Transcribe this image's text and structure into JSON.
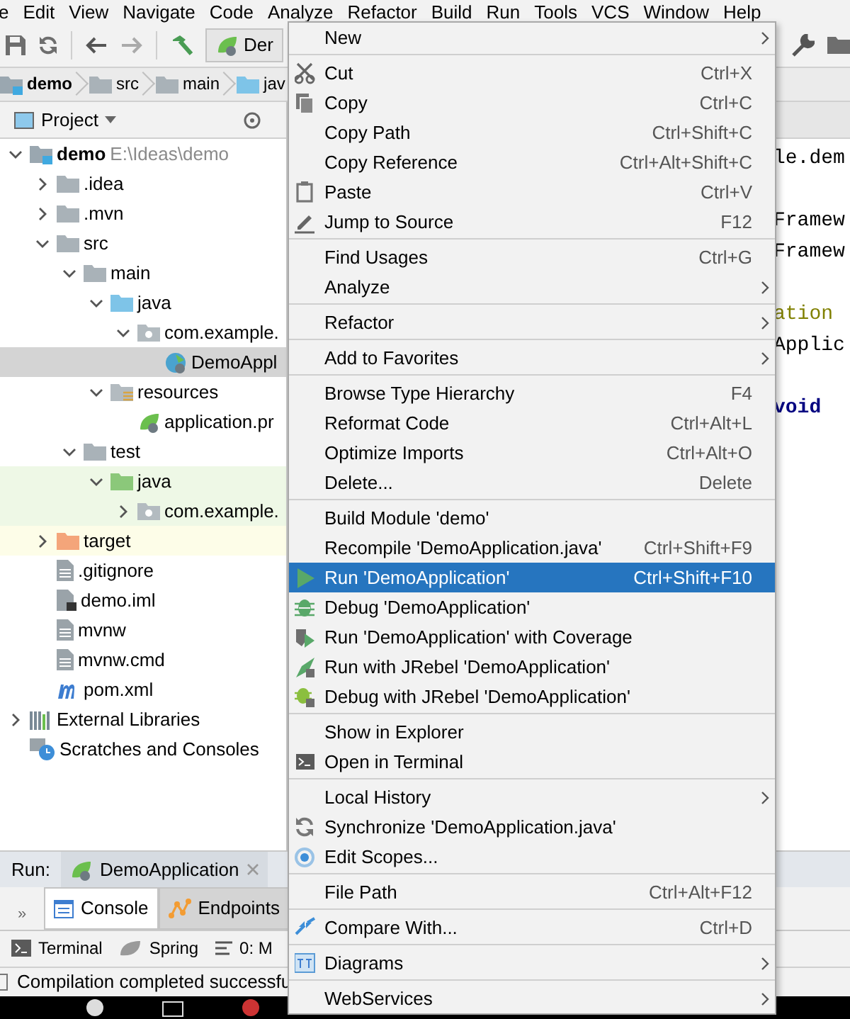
{
  "menubar": [
    "e",
    "Edit",
    "View",
    "Navigate",
    "Code",
    "Analyze",
    "Refactor",
    "Build",
    "Run",
    "Tools",
    "VCS",
    "Window",
    "Help"
  ],
  "toolbar": {
    "run_config": "Der"
  },
  "breadcrumbs": [
    {
      "label": "demo",
      "kind": "module"
    },
    {
      "label": "src",
      "kind": "folder"
    },
    {
      "label": "main",
      "kind": "folder"
    },
    {
      "label": "jav",
      "kind": "source-folder"
    }
  ],
  "project_panel": {
    "title": "Project",
    "tree": [
      {
        "label": "demo",
        "hint": "E:\\Ideas\\demo",
        "kind": "module",
        "expanded": true,
        "selected": false,
        "children": [
          {
            "label": ".idea",
            "kind": "folder",
            "expanded": false,
            "selected": false
          },
          {
            "label": ".mvn",
            "kind": "folder",
            "expanded": false,
            "selected": false
          },
          {
            "label": "src",
            "kind": "folder",
            "expanded": true,
            "selected": false,
            "children": [
              {
                "label": "main",
                "kind": "folder",
                "expanded": true,
                "selected": false,
                "children": [
                  {
                    "label": "java",
                    "kind": "source-folder",
                    "expanded": true,
                    "selected": false,
                    "children": [
                      {
                        "label": "com.example.",
                        "kind": "package",
                        "expanded": true,
                        "selected": false,
                        "children": [
                          {
                            "label": "DemoAppl",
                            "kind": "spring-class",
                            "selected": true
                          }
                        ]
                      }
                    ]
                  },
                  {
                    "label": "resources",
                    "kind": "resource-folder",
                    "expanded": true,
                    "selected": false,
                    "children": [
                      {
                        "label": "application.pr",
                        "kind": "spring-config",
                        "selected": false
                      }
                    ]
                  }
                ]
              },
              {
                "label": "test",
                "kind": "folder",
                "expanded": true,
                "selected": false,
                "children": [
                  {
                    "label": "java",
                    "kind": "test-folder",
                    "expanded": true,
                    "selected": false,
                    "children": [
                      {
                        "label": "com.example.",
                        "kind": "package",
                        "expanded": false,
                        "selected": false
                      }
                    ]
                  }
                ]
              }
            ]
          },
          {
            "label": "target",
            "kind": "excluded-folder",
            "expanded": false,
            "selected": false
          },
          {
            "label": ".gitignore",
            "kind": "file",
            "selected": false
          },
          {
            "label": "demo.iml",
            "kind": "iml",
            "selected": false
          },
          {
            "label": "mvnw",
            "kind": "file",
            "selected": false
          },
          {
            "label": "mvnw.cmd",
            "kind": "file",
            "selected": false
          },
          {
            "label": "pom.xml",
            "kind": "maven",
            "selected": false
          }
        ]
      },
      {
        "label": "External Libraries",
        "kind": "libraries",
        "expanded": false,
        "selected": false
      },
      {
        "label": "Scratches and Consoles",
        "kind": "scratches",
        "selected": false
      }
    ]
  },
  "editor": {
    "lines": [
      {
        "text": "le.dem",
        "kind": "plain"
      },
      {
        "text": "Framew",
        "kind": "plain"
      },
      {
        "text": "Framew",
        "kind": "plain"
      },
      {
        "text": "ation",
        "kind": "annotation"
      },
      {
        "text": "Applic",
        "kind": "plain"
      },
      {
        "text": "void",
        "kind": "keyword"
      }
    ]
  },
  "run_panel": {
    "label": "Run:",
    "tab": "DemoApplication",
    "more": "»",
    "tabs": [
      {
        "label": "Console",
        "selected": true
      },
      {
        "label": "Endpoints",
        "selected": false
      }
    ]
  },
  "tool_windows": [
    "Terminal",
    "Spring",
    "0: M"
  ],
  "status_bar": "Compilation completed successfu",
  "context_menu": {
    "groups": [
      [
        {
          "label": "New",
          "submenu": true,
          "selected": false
        }
      ],
      [
        {
          "label": "Cut",
          "shortcut": "Ctrl+X",
          "submenu": false,
          "selected": false
        },
        {
          "label": "Copy",
          "shortcut": "Ctrl+C",
          "submenu": false,
          "selected": false
        },
        {
          "label": "Copy Path",
          "shortcut": "Ctrl+Shift+C",
          "submenu": false,
          "selected": false
        },
        {
          "label": "Copy Reference",
          "shortcut": "Ctrl+Alt+Shift+C",
          "submenu": false,
          "selected": false
        },
        {
          "label": "Paste",
          "shortcut": "Ctrl+V",
          "submenu": false,
          "selected": false
        },
        {
          "label": "Jump to Source",
          "shortcut": "F12",
          "submenu": false,
          "selected": false
        }
      ],
      [
        {
          "label": "Find Usages",
          "shortcut": "Ctrl+G",
          "submenu": false,
          "selected": false
        },
        {
          "label": "Analyze",
          "submenu": true,
          "selected": false
        }
      ],
      [
        {
          "label": "Refactor",
          "submenu": true,
          "selected": false
        }
      ],
      [
        {
          "label": "Add to Favorites",
          "submenu": true,
          "selected": false
        }
      ],
      [
        {
          "label": "Browse Type Hierarchy",
          "shortcut": "F4",
          "submenu": false,
          "selected": false
        },
        {
          "label": "Reformat Code",
          "shortcut": "Ctrl+Alt+L",
          "submenu": false,
          "selected": false
        },
        {
          "label": "Optimize Imports",
          "shortcut": "Ctrl+Alt+O",
          "submenu": false,
          "selected": false
        },
        {
          "label": "Delete...",
          "shortcut": "Delete",
          "submenu": false,
          "selected": false
        }
      ],
      [
        {
          "label": "Build Module 'demo'",
          "submenu": false,
          "selected": false
        },
        {
          "label": "Recompile 'DemoApplication.java'",
          "shortcut": "Ctrl+Shift+F9",
          "submenu": false,
          "selected": false
        },
        {
          "label": "Run 'DemoApplication'",
          "shortcut": "Ctrl+Shift+F10",
          "submenu": false,
          "selected": true
        },
        {
          "label": "Debug 'DemoApplication'",
          "submenu": false,
          "selected": false
        },
        {
          "label": "Run 'DemoApplication' with Coverage",
          "submenu": false,
          "selected": false
        },
        {
          "label": "Run with JRebel 'DemoApplication'",
          "submenu": false,
          "selected": false
        },
        {
          "label": "Debug with JRebel 'DemoApplication'",
          "submenu": false,
          "selected": false
        }
      ],
      [
        {
          "label": "Show in Explorer",
          "submenu": false,
          "selected": false
        },
        {
          "label": "Open in Terminal",
          "submenu": false,
          "selected": false
        }
      ],
      [
        {
          "label": "Local History",
          "submenu": true,
          "selected": false
        },
        {
          "label": "Synchronize 'DemoApplication.java'",
          "submenu": false,
          "selected": false
        },
        {
          "label": "Edit Scopes...",
          "submenu": false,
          "selected": false
        }
      ],
      [
        {
          "label": "File Path",
          "shortcut": "Ctrl+Alt+F12",
          "submenu": false,
          "selected": false
        }
      ],
      [
        {
          "label": "Compare With...",
          "shortcut": "Ctrl+D",
          "submenu": false,
          "selected": false
        }
      ],
      [
        {
          "label": "Diagrams",
          "submenu": true,
          "selected": false
        }
      ],
      [
        {
          "label": "WebServices",
          "submenu": true,
          "selected": false
        }
      ]
    ]
  }
}
